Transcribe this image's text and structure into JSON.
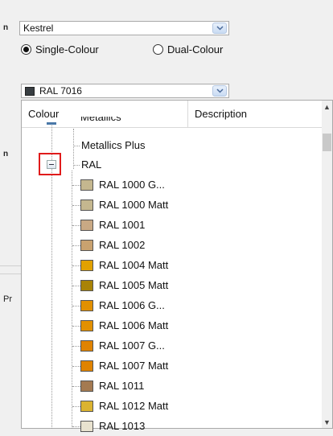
{
  "left_fragments": [
    "n",
    "n",
    "Pr"
  ],
  "profile_combo": {
    "value": "Kestrel"
  },
  "radio_options": [
    {
      "label": "Single-Colour",
      "selected": true
    },
    {
      "label": "Dual-Colour",
      "selected": false
    }
  ],
  "colour_combo": {
    "value": "RAL 7016",
    "swatch": "#383e42"
  },
  "list": {
    "columns": [
      "Colour",
      "Description"
    ],
    "partial_top_label": "Metallics",
    "groups": [
      "Metallics Plus",
      "RAL"
    ],
    "items": [
      {
        "label": "RAL 1000 G...",
        "color": "#c5b78f"
      },
      {
        "label": "RAL 1000 Matt",
        "color": "#c5b78f"
      },
      {
        "label": "RAL 1001",
        "color": "#c9a984"
      },
      {
        "label": "RAL 1002",
        "color": "#c9a26f"
      },
      {
        "label": "RAL 1004 Matt",
        "color": "#e1a100"
      },
      {
        "label": "RAL 1005 Matt",
        "color": "#a98307"
      },
      {
        "label": "RAL 1006 G...",
        "color": "#e29000"
      },
      {
        "label": "RAL 1006 Matt",
        "color": "#e29000"
      },
      {
        "label": "RAL 1007 G...",
        "color": "#e08300"
      },
      {
        "label": "RAL 1007 Matt",
        "color": "#e08300"
      },
      {
        "label": "RAL 1011",
        "color": "#a47a51"
      },
      {
        "label": "RAL 1012 Matt",
        "color": "#dbb330"
      },
      {
        "label": "RAL 1013",
        "color": "#e8e2cf"
      }
    ]
  },
  "highlight_color": "#e01b1b"
}
